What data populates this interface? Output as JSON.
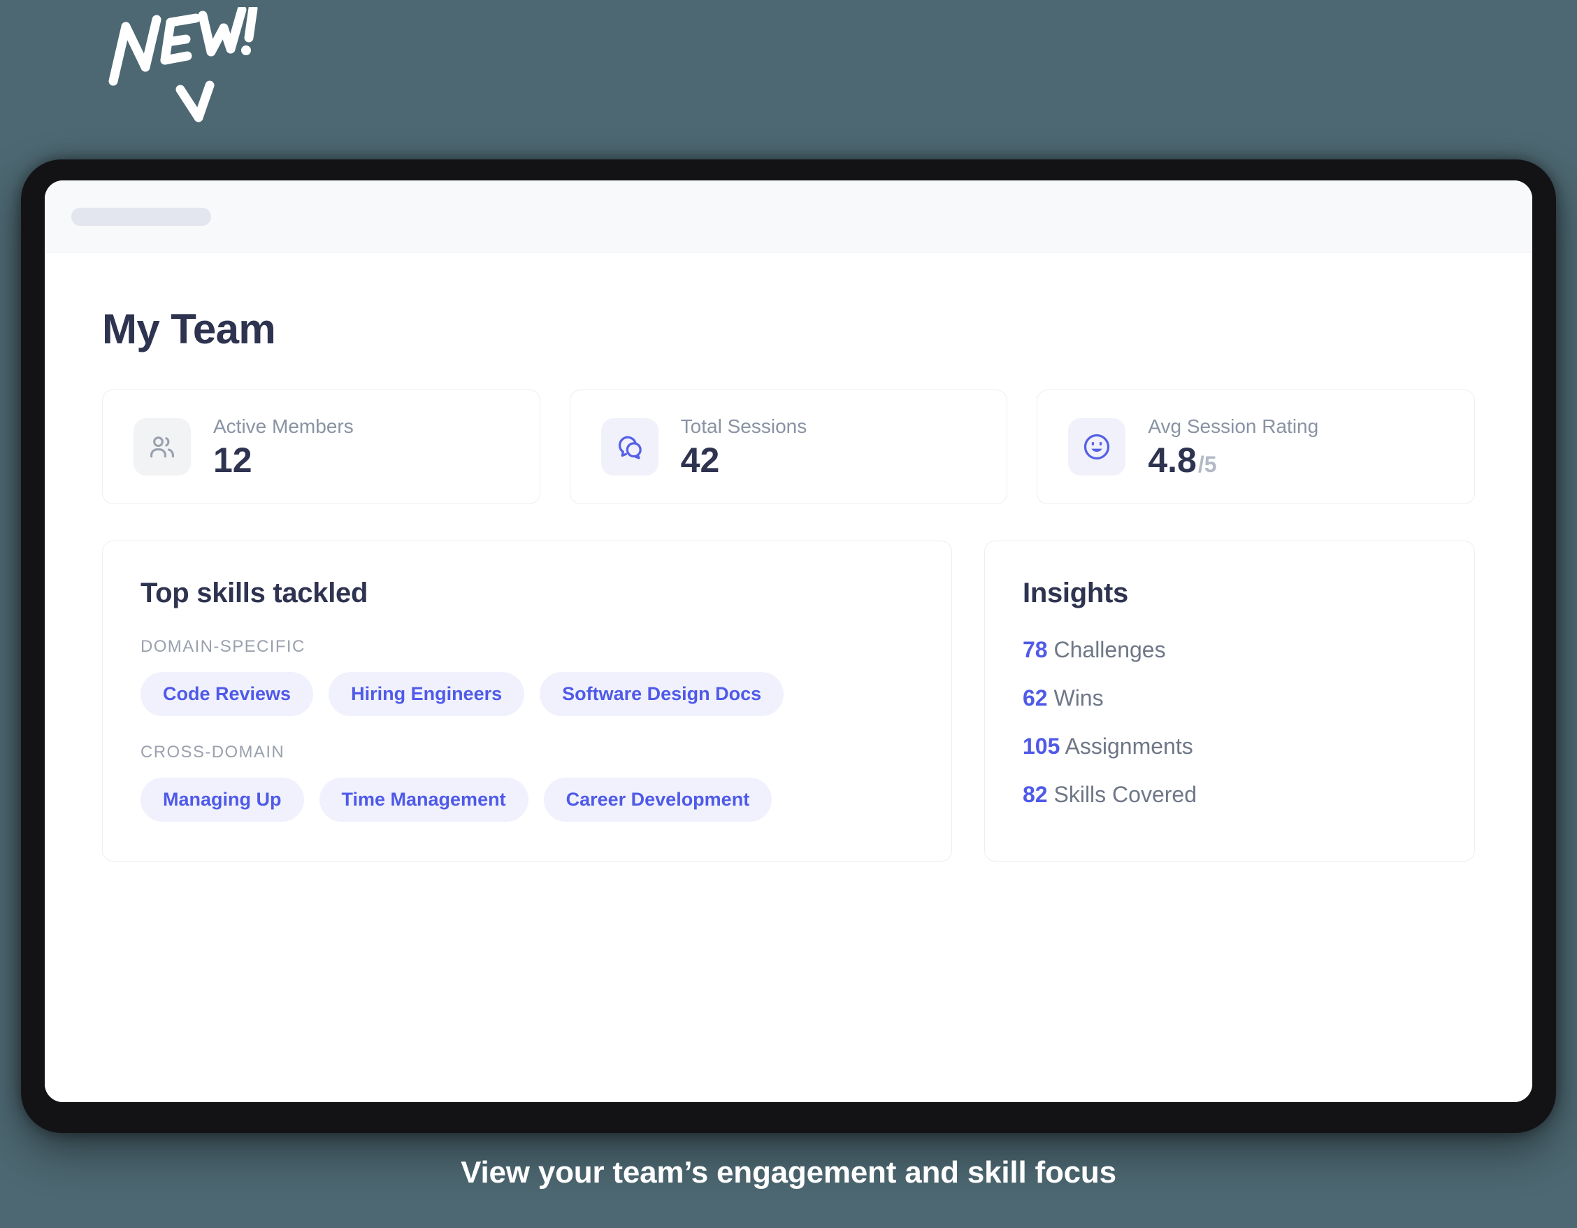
{
  "sticker": {
    "text": "NEW!",
    "arrow": "down-chevron"
  },
  "browser": {
    "url_pill_placeholder": ""
  },
  "header": {
    "title": "My Team"
  },
  "stats": [
    {
      "icon": "users-icon",
      "icon_style": "gray",
      "label": "Active Members",
      "value": "12",
      "suffix": ""
    },
    {
      "icon": "chat-bubbles-icon",
      "icon_style": "lav",
      "label": "Total Sessions",
      "value": "42",
      "suffix": ""
    },
    {
      "icon": "smiley-face-icon",
      "icon_style": "lav",
      "label": "Avg Session Rating",
      "value": "4.8",
      "suffix": "/5"
    }
  ],
  "skills": {
    "title": "Top skills tackled",
    "groups": [
      {
        "label": "Domain-specific",
        "items": [
          "Code Reviews",
          "Hiring Engineers",
          "Software Design Docs"
        ]
      },
      {
        "label": "Cross-domain",
        "items": [
          "Managing Up",
          "Time Management",
          "Career Development"
        ]
      }
    ]
  },
  "insights": {
    "title": "Insights",
    "items": [
      {
        "number": "78",
        "label": "Challenges"
      },
      {
        "number": "62",
        "label": "Wins"
      },
      {
        "number": "105",
        "label": "Assignments"
      },
      {
        "number": "82",
        "label": "Skills Covered"
      }
    ]
  },
  "caption": {
    "text": "View your team’s engagement and skill focus"
  },
  "colors": {
    "background": "#4d6872",
    "accent": "#4f5ae8",
    "pill_bg": "#f0f1fd",
    "heading": "#2e3350",
    "muted": "#8a93a3"
  }
}
